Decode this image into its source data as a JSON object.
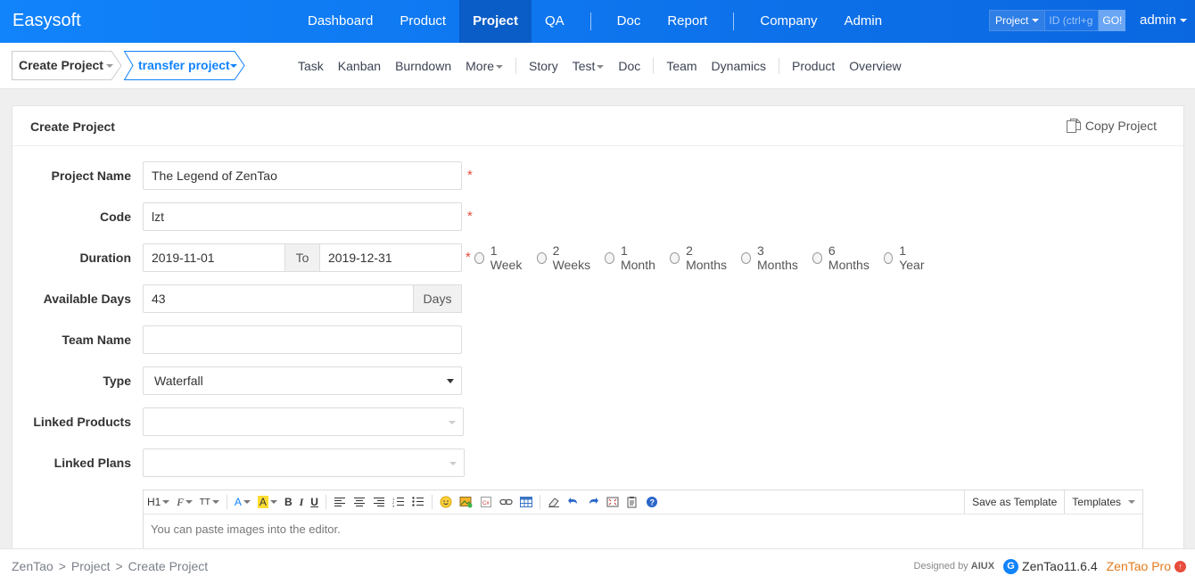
{
  "brand": "Easysoft",
  "main_nav": [
    {
      "label": "Dashboard",
      "active": false
    },
    {
      "label": "Product",
      "active": false
    },
    {
      "label": "Project",
      "active": true
    },
    {
      "label": "QA",
      "active": false
    },
    {
      "divider": true
    },
    {
      "label": "Doc",
      "active": false
    },
    {
      "label": "Report",
      "active": false
    },
    {
      "divider": true
    },
    {
      "label": "Company",
      "active": false
    },
    {
      "label": "Admin",
      "active": false
    }
  ],
  "search": {
    "type_label": "Project",
    "placeholder": "ID (ctrl+g",
    "go_label": "GO!"
  },
  "user": {
    "name": "admin"
  },
  "breadcrumb": {
    "first": "Create Project",
    "second": "transfer project"
  },
  "sub_nav": [
    {
      "label": "Task"
    },
    {
      "label": "Kanban"
    },
    {
      "label": "Burndown"
    },
    {
      "label": "More",
      "dropdown": true
    },
    {
      "divider": true
    },
    {
      "label": "Story"
    },
    {
      "label": "Test",
      "dropdown": true
    },
    {
      "label": "Doc"
    },
    {
      "divider": true
    },
    {
      "label": "Team"
    },
    {
      "label": "Dynamics"
    },
    {
      "divider": true
    },
    {
      "label": "Product"
    },
    {
      "label": "Overview"
    }
  ],
  "panel": {
    "title": "Create Project",
    "copy_label": "Copy Project"
  },
  "form": {
    "project_name_label": "Project Name",
    "project_name_value": "The Legend of ZenTao",
    "code_label": "Code",
    "code_value": "lzt",
    "duration_label": "Duration",
    "start_date": "2019-11-01",
    "to_label": "To",
    "end_date": "2019-12-31",
    "required_mark": "*",
    "duration_options": [
      "1 Week",
      "2 Weeks",
      "1 Month",
      "2 Months",
      "3 Months",
      "6 Months",
      "1 Year"
    ],
    "available_days_label": "Available Days",
    "available_days_value": "43",
    "days_addon": "Days",
    "team_name_label": "Team Name",
    "team_name_value": "",
    "type_label": "Type",
    "type_value": "Waterfall",
    "linked_products_label": "Linked Products",
    "linked_plans_label": "Linked Plans"
  },
  "editor": {
    "save_template_label": "Save as Template",
    "templates_label": "Templates",
    "placeholder": "You can paste images into the editor.",
    "tool_h1": "H1",
    "tool_font": "F",
    "tool_size": "TT",
    "tool_bold": "B",
    "tool_italic": "I",
    "tool_underline": "U"
  },
  "footer": {
    "crumbs": [
      "ZenTao",
      "Project",
      "Create Project"
    ],
    "crumb_sep": ">",
    "designed_by": "Designed by",
    "designer": "AIUX",
    "version": "ZenTao11.6.4",
    "pro_label": "ZenTao Pro"
  },
  "colors": {
    "accent": "#1183fb",
    "required": "#e74c3c",
    "pro": "#e27a1c"
  }
}
